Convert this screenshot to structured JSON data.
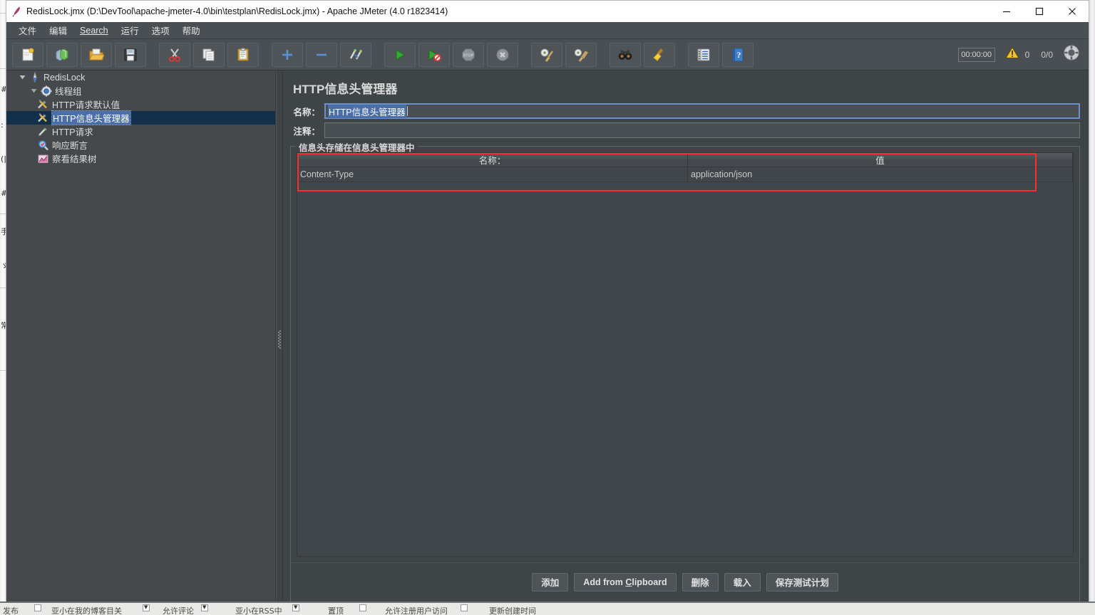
{
  "window": {
    "title": "RedisLock.jmx (D:\\DevTool\\apache-jmeter-4.0\\bin\\testplan\\RedisLock.jmx) - Apache JMeter (4.0 r1823414)",
    "app_icon": "jmeter-feather-icon",
    "controls": {
      "minimize": "minimize-icon",
      "maximize": "maximize-icon",
      "close": "close-icon"
    }
  },
  "menu": {
    "items": [
      {
        "label": "文件",
        "mnemonic": ""
      },
      {
        "label": "编辑",
        "mnemonic": ""
      },
      {
        "label": "Search",
        "mnemonic": "S"
      },
      {
        "label": "运行",
        "mnemonic": ""
      },
      {
        "label": "选项",
        "mnemonic": ""
      },
      {
        "label": "帮助",
        "mnemonic": ""
      }
    ]
  },
  "toolbar": {
    "buttons": [
      {
        "name": "new-button",
        "icon": "new-document-icon"
      },
      {
        "name": "templates-button",
        "icon": "templates-books-icon"
      },
      {
        "name": "open-button",
        "icon": "open-folder-icon"
      },
      {
        "name": "save-button",
        "icon": "floppy-save-icon"
      },
      {
        "name": "cut-button",
        "icon": "scissors-cut-icon"
      },
      {
        "name": "copy-button",
        "icon": "copy-pages-icon"
      },
      {
        "name": "paste-button",
        "icon": "clipboard-paste-icon"
      },
      {
        "name": "expand-all-button",
        "icon": "plus-icon"
      },
      {
        "name": "collapse-all-button",
        "icon": "minus-icon"
      },
      {
        "name": "toggle-button",
        "icon": "toggle-pencils-icon"
      },
      {
        "name": "start-button",
        "icon": "green-play-icon"
      },
      {
        "name": "start-no-pauses-button",
        "icon": "green-play-no-pause-icon"
      },
      {
        "name": "stop-button",
        "icon": "stop-sign-icon"
      },
      {
        "name": "shutdown-button",
        "icon": "shutdown-x-icon"
      },
      {
        "name": "clear-button",
        "icon": "gear-broom-icon"
      },
      {
        "name": "clear-all-button",
        "icon": "gear-broom-all-icon"
      },
      {
        "name": "search-button",
        "icon": "binoculars-icon"
      },
      {
        "name": "reset-search-button",
        "icon": "yellow-brush-icon"
      },
      {
        "name": "function-helper-button",
        "icon": "notepad-list-icon"
      },
      {
        "name": "help-button",
        "icon": "blue-question-book-icon"
      }
    ],
    "elapsed_time": "00:00:00",
    "warning_icon": "warning-triangle-icon",
    "warning_count": "0",
    "thread_counts": "0/0",
    "connect_icon": "remote-connect-icon"
  },
  "tree": {
    "nodes": [
      {
        "label": "RedisLock",
        "icon": "test-plan-icon",
        "depth": 0,
        "expander": "expanded",
        "selected": false
      },
      {
        "label": "线程组",
        "icon": "thread-group-icon",
        "depth": 1,
        "expander": "expanded",
        "selected": false
      },
      {
        "label": "HTTP请求默认值",
        "icon": "http-defaults-icon",
        "depth": 2,
        "expander": "none",
        "selected": false
      },
      {
        "label": "HTTP信息头管理器",
        "icon": "header-manager-icon",
        "depth": 2,
        "expander": "none",
        "selected": true
      },
      {
        "label": "HTTP请求",
        "icon": "http-sampler-icon",
        "depth": 2,
        "expander": "none",
        "selected": false
      },
      {
        "label": "响应断言",
        "icon": "assertion-icon",
        "depth": 2,
        "expander": "none",
        "selected": false
      },
      {
        "label": "察看结果树",
        "icon": "view-results-icon",
        "depth": 2,
        "expander": "none",
        "selected": false
      }
    ]
  },
  "panel": {
    "title": "HTTP信息头管理器",
    "name_label": "名称：",
    "name_value": "HTTP信息头管理器",
    "comment_label": "注释：",
    "comment_value": "",
    "group_legend": "信息头存储在信息头管理器中",
    "table": {
      "columns": [
        "名称：",
        "值"
      ],
      "rows": [
        {
          "name": "Content-Type",
          "value": "application/json"
        }
      ]
    },
    "buttons": [
      {
        "label": "添加",
        "mnemonic": "",
        "name": "add-button"
      },
      {
        "label": "Add from Clipboard",
        "mnemonic": "C",
        "name": "add-from-clipboard-button"
      },
      {
        "label": "删除",
        "mnemonic": "",
        "name": "delete-button"
      },
      {
        "label": "载入",
        "mnemonic": "",
        "name": "load-button"
      },
      {
        "label": "保存测试计划",
        "mnemonic": "",
        "name": "save-test-plan-button"
      }
    ]
  },
  "annotation": {
    "color": "#ff2e2e",
    "shape": "rectangle"
  },
  "background_strip": {
    "cells": [
      "发布",
      "亚小在我的博客目关",
      "允许评论",
      "亚小在RSS中",
      "置顶",
      "允许注册用户访问",
      "更新创建时间"
    ]
  }
}
